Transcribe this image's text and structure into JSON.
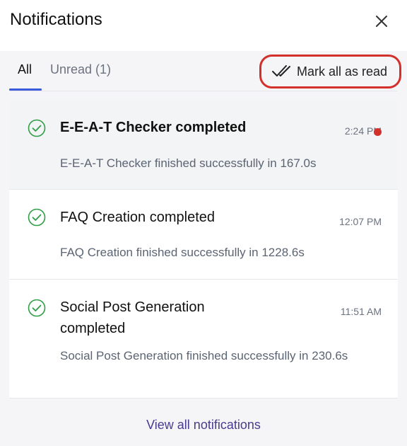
{
  "header": {
    "title": "Notifications",
    "close_icon": "close-icon"
  },
  "tabs": [
    {
      "label": "All",
      "active": true
    },
    {
      "label": "Unread (1)",
      "active": false
    }
  ],
  "mark_all": {
    "label": "Mark all as read",
    "icon": "double-check-icon",
    "highlight_color": "#d4302b"
  },
  "notifications": [
    {
      "title": "E-E-A-T Checker completed",
      "description": "E-E-A-T Checker finished successfully in 167.0s",
      "time": "2:24 PM",
      "unread": true,
      "icon": "check-circle-icon"
    },
    {
      "title": "FAQ Creation completed",
      "description": "FAQ Creation finished successfully in 1228.6s",
      "time": "12:07 PM",
      "unread": false,
      "icon": "check-circle-icon"
    },
    {
      "title": "Social Post Generation completed",
      "description": "Social Post Generation finished successfully in 230.6s",
      "time": "11:51 AM",
      "unread": false,
      "icon": "check-circle-icon"
    }
  ],
  "footer": {
    "view_all_label": "View all notifications"
  },
  "colors": {
    "accent": "#3b5bdb",
    "success": "#2f9e44",
    "unread_dot": "#d4302b",
    "link": "#4a3b8f"
  }
}
